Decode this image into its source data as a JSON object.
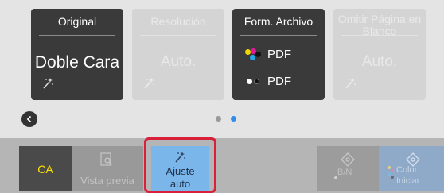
{
  "cards": [
    {
      "title": "Original",
      "value": "Doble Cara",
      "state": "active"
    },
    {
      "title": "Resolución",
      "value": "Auto.",
      "state": "disabled"
    },
    {
      "title": "Form. Archivo",
      "state": "active",
      "color_format": "PDF",
      "bw_format": "PDF"
    },
    {
      "title": "Omitir Página en Blanco",
      "value": "Auto.",
      "state": "disabled"
    }
  ],
  "pagination": {
    "current_page": 2,
    "total_pages": 2
  },
  "bottom": {
    "ca_label": "CA",
    "preview_label": "Vista previa",
    "auto_label_line1": "Ajuste",
    "auto_label_line2": "auto",
    "bn_label": "B/N",
    "color_label": "Color",
    "start_label": "Iniciar"
  },
  "colors": {
    "accent_yellow": "#ffe000",
    "highlight_red": "#d8203a",
    "selected_blue": "#7ab6ea",
    "page_dot_active": "#2f8fe8"
  }
}
